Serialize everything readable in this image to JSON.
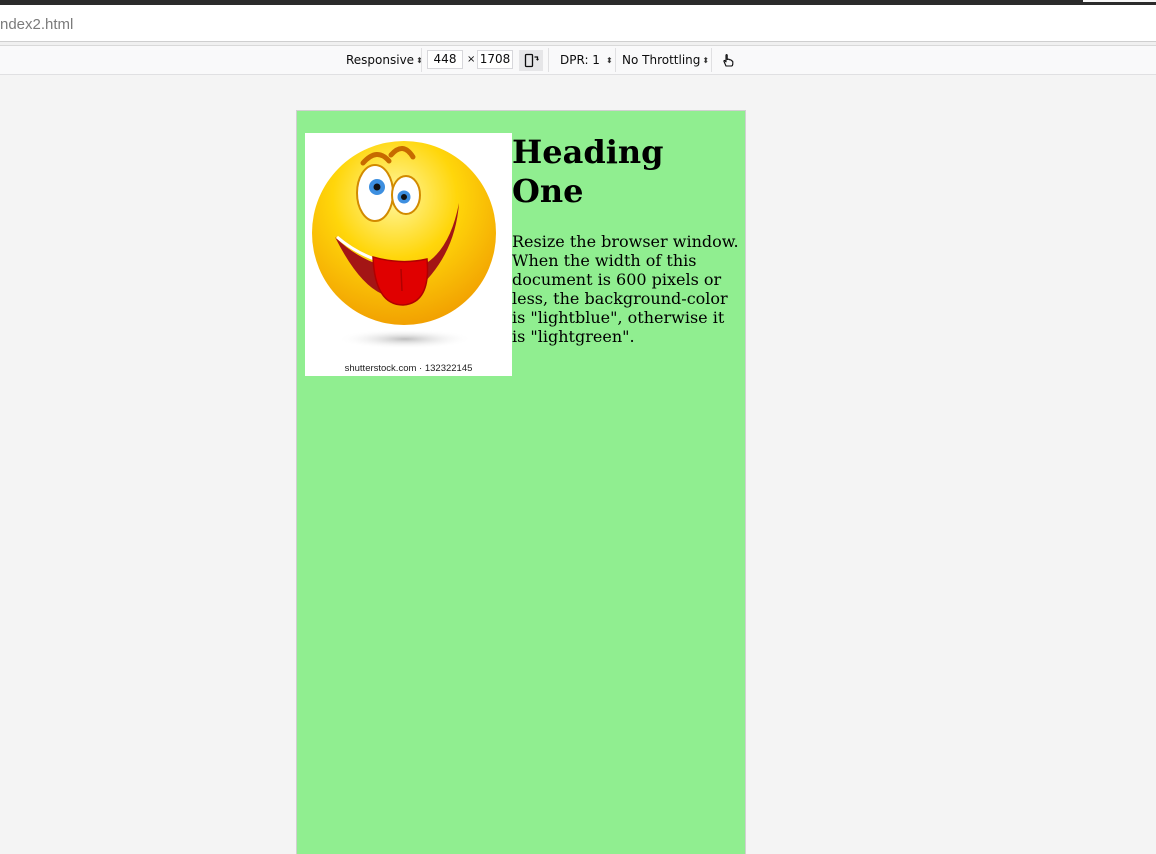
{
  "browser": {
    "url_text": "ndex2.html"
  },
  "rdm_toolbar": {
    "device_label": "Responsive",
    "width_value": "448",
    "times_symbol": "×",
    "height_value": "1708",
    "dpr_label": "DPR: 1",
    "throttling_label": "No Throttling",
    "icons": [
      "rotate-icon",
      "touch-hand-icon",
      "updown-arrows-icon"
    ]
  },
  "page": {
    "background_color": "#90ee90",
    "heading": "Heading One",
    "paragraph": "Resize the browser window. When the width of this document is 600 pixels or less, the background-color is \"lightblue\", otherwise it is \"lightgreen\".",
    "image": {
      "subject": "smiley-face-tongue-out",
      "caption": "shutterstock.com · 132322145"
    }
  }
}
